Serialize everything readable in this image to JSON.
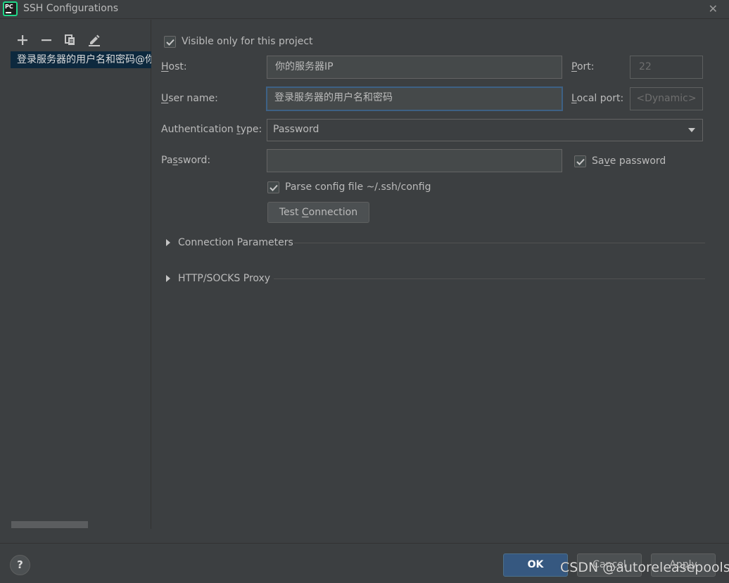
{
  "window": {
    "title": "SSH Configurations",
    "app_logo_text": "PC",
    "close_glyph": "✕"
  },
  "sidebar": {
    "toolbar": [
      {
        "name": "add",
        "glyph": "+"
      },
      {
        "name": "remove",
        "glyph": "−"
      },
      {
        "name": "copy",
        "glyph": "copy-icon"
      },
      {
        "name": "edit",
        "glyph": "pencil-icon"
      }
    ],
    "items": [
      {
        "label": "登录服务器的用户名和密码@你的服务器IP",
        "selected": true
      }
    ]
  },
  "form": {
    "visible_only": {
      "label": "Visible only for this project",
      "checked": true
    },
    "host": {
      "label_pre": "",
      "label_u": "H",
      "label_post": "ost:",
      "value": "你的服务器IP"
    },
    "port": {
      "label_pre": "",
      "label_u": "P",
      "label_post": "ort:",
      "value": "22"
    },
    "user_name": {
      "label_pre": "",
      "label_u": "U",
      "label_post": "ser name:",
      "value": "登录服务器的用户名和密码"
    },
    "local_port": {
      "label_pre": "",
      "label_u": "L",
      "label_post": "ocal port:",
      "value": "<Dynamic>"
    },
    "auth_type": {
      "label_pre": "Authentication ",
      "label_u": "t",
      "label_post": "ype:",
      "value": "Password"
    },
    "password": {
      "label_pre": "Pa",
      "label_u": "s",
      "label_post": "sword:",
      "value": ""
    },
    "save_password": {
      "label_pre": "Sa",
      "label_u": "v",
      "label_post": "e password",
      "checked": true
    },
    "parse_config": {
      "label": "Parse config file ~/.ssh/config",
      "checked": true
    },
    "test_connection": {
      "label_pre": "Test ",
      "label_u": "C",
      "label_post": "onnection"
    }
  },
  "sections": [
    {
      "label": "Connection Parameters",
      "expanded": false
    },
    {
      "label": "HTTP/SOCKS Proxy",
      "expanded": false
    }
  ],
  "footer": {
    "help": "?",
    "ok": "OK",
    "cancel": "Cancel",
    "apply": "Apply"
  },
  "watermark": "CSDN @autoreleasepools",
  "colors": {
    "background": "#3c3f41",
    "selection": "#0d293e",
    "focus_border": "#3d6185",
    "primary_button": "#365880"
  }
}
